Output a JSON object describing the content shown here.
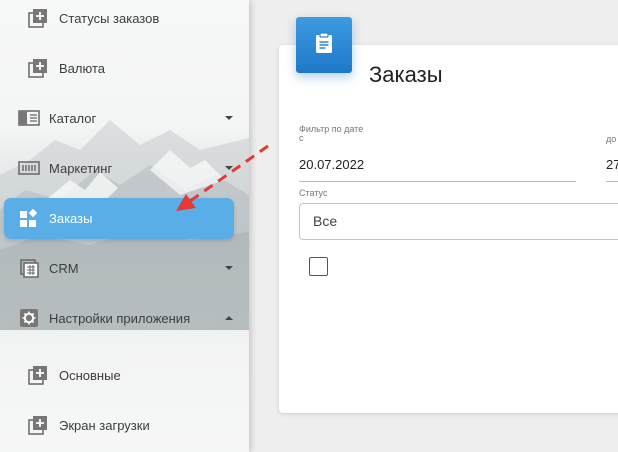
{
  "sidebar": {
    "items": [
      {
        "label": "Статусы заказов",
        "icon": "add-box-icon"
      },
      {
        "label": "Валюта",
        "icon": "add-box-icon"
      },
      {
        "label": "Каталог",
        "icon": "catalog-icon"
      },
      {
        "label": "Маркетинг",
        "icon": "marketing-icon"
      },
      {
        "label": "Заказы",
        "icon": "widgets-icon"
      },
      {
        "label": "CRM",
        "icon": "crm-icon"
      },
      {
        "label": "Настройки приложения",
        "icon": "gear-icon"
      },
      {
        "label": "Основные",
        "icon": "add-box-icon"
      },
      {
        "label": "Экран загрузки",
        "icon": "add-box-icon"
      }
    ],
    "active_item": "Заказы",
    "accent_color": "#5aaee8"
  },
  "card": {
    "title": "Заказы",
    "badge_icon": "clipboard-icon",
    "filter": {
      "from_label_line1": "Фильтр по дате",
      "from_label_line2": "с",
      "from_value": "20.07.2022",
      "to_label": "до",
      "to_value": "27"
    },
    "status": {
      "label": "Статус",
      "value": "Все"
    }
  },
  "annotation": {
    "arrow_color": "#e53935"
  }
}
